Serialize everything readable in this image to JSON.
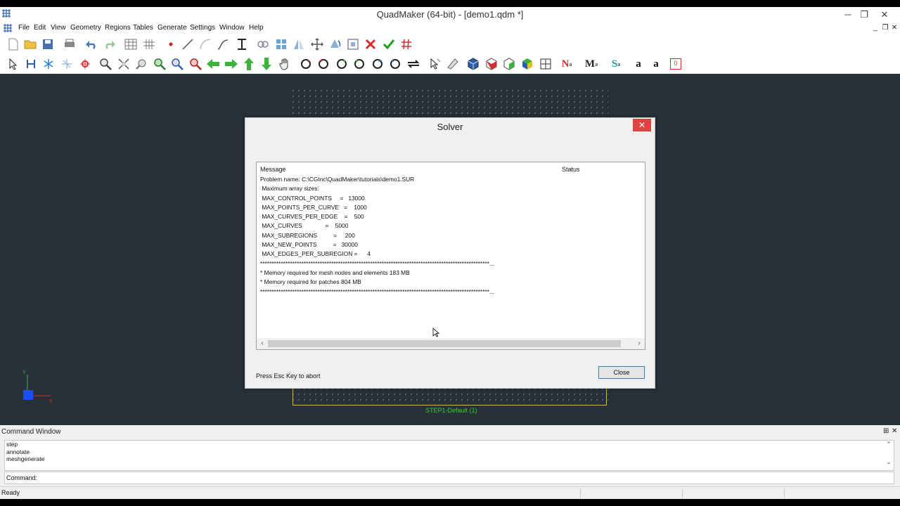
{
  "window": {
    "title": "QuadMaker (64-bit) - [demo1.qdm *]",
    "minimize": "─",
    "maximize": "❐",
    "close": "✕"
  },
  "menu": {
    "items": [
      "File",
      "Edit",
      "View",
      "Geometry",
      "Regions",
      "Tables",
      "Generate",
      "Settings",
      "Window",
      "Help"
    ],
    "mdi_minimize": "_",
    "mdi_restore": "❐",
    "mdi_close": "✕"
  },
  "toolbar1": {
    "icons": [
      "new-file-icon",
      "open-folder-icon",
      "save-icon",
      "print-icon",
      "undo-icon",
      "redo-icon",
      "grid-icon",
      "grid-lines-icon",
      "point-icon",
      "line-icon",
      "arc-icon",
      "curve-icon",
      "i-beam-icon",
      "link-icon",
      "region-grid-icon",
      "mirror-icon",
      "move-icon",
      "rotate-icon",
      "scale-icon",
      "delete-icon",
      "check-icon",
      "hash-icon"
    ]
  },
  "toolbar2": {
    "icons": [
      "select-arrow-icon",
      "h-select-icon",
      "star-select-icon",
      "asterisk-icon",
      "target-icon",
      "zoom-window-icon",
      "zoom-extents-icon",
      "pan-zoom-icon",
      "zoom-in-icon",
      "zoom-out-icon",
      "zoom-fit-icon",
      "arrow-left-icon",
      "arrow-right-icon",
      "arrow-up-icon",
      "arrow-down-icon",
      "hand-pan-icon",
      "rotate-x-icon",
      "rotate-y-icon",
      "rotate-z-icon",
      "rotate-x2-icon",
      "rotate-z2-icon",
      "rotate-y2-icon",
      "flip-icon",
      "pick-icon",
      "erase-icon",
      "cube-blue-icon",
      "cube-red-icon",
      "cube-green-icon",
      "cube-color-icon",
      "mesh-grid-icon",
      "node-number-icon",
      "material-number-icon",
      "surface-number-icon",
      "text-a-icon",
      "text-a-bold-icon",
      "box-zero-icon"
    ],
    "labels": {
      "n": "N",
      "m": "M",
      "s": "S",
      "a1": "a",
      "a2": "a",
      "box": "0"
    }
  },
  "viewport": {
    "step_label": "STEP1-Default (1)",
    "axis_y": "Y",
    "axis_x": "X"
  },
  "dialog": {
    "title": "Solver",
    "header_message": "Message",
    "header_status": "Status",
    "lines": [
      "Problem name: C:\\CGInc\\QuadMaker\\tutorials\\demo1.SUR",
      " Maximum array sizes:",
      " MAX_CONTROL_POINTS     =   13000",
      " MAX_POINTS_PER_CURVE   =    1000",
      " MAX_CURVES_PER_EDGE    =    500",
      " MAX_CURVES              =    5000",
      " MAX_SUBREGIONS          =     200",
      " MAX_NEW_POINTS          =   30000",
      " MAX_EDGES_PER_SUBREGION =      4",
      "****************************************************************************************************...",
      "* Memory required for mesh nodes and elements 183 MB",
      "* Memory required for patches 804 MB",
      "****************************************************************************************************..."
    ],
    "scroll_left": "‹",
    "scroll_right": "›",
    "abort_hint": "Press Esc Key to abort",
    "close_button": "Close",
    "close_x": "✕"
  },
  "command_window": {
    "title": "Command Window",
    "pin": "⊞",
    "close": "✕",
    "history": [
      "step",
      "annotate",
      "meshgenerate"
    ],
    "prompt": "Command:",
    "scroll_up": "⌃",
    "scroll_down": "⌄"
  },
  "status": {
    "text": "Ready"
  }
}
